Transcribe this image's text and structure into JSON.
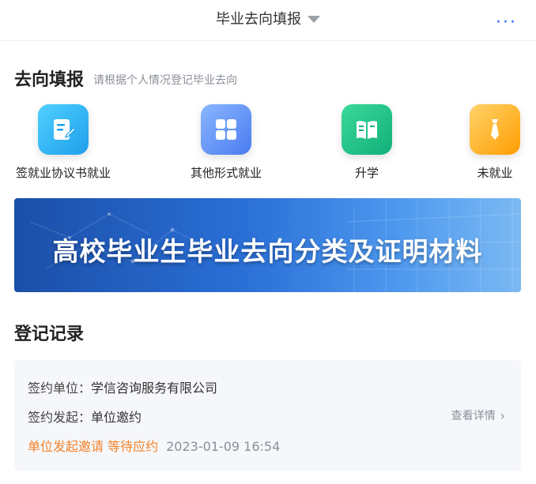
{
  "header": {
    "title": "毕业去向填报",
    "more_label": "···"
  },
  "section": {
    "title": "去向填报",
    "subtitle": "请根据个人情况登记毕业去向"
  },
  "tiles": [
    {
      "label": "签就业协议书就业",
      "icon": "contract-edit-icon",
      "color": "#1f9eea"
    },
    {
      "label": "其他形式就业",
      "icon": "grid-apps-icon",
      "color": "#4a7bf0"
    },
    {
      "label": "升学",
      "icon": "book-icon",
      "color": "#12b07a"
    },
    {
      "label": "未就业",
      "icon": "tie-icon",
      "color": "#ff9d00"
    }
  ],
  "banner": {
    "text": "高校毕业生毕业去向分类及证明材料"
  },
  "records": {
    "title": "登记记录",
    "items": [
      {
        "unit_key": "签约单位：",
        "unit_value": "学信咨询服务有限公司",
        "initiator_key": "签约发起：",
        "initiator_value": "单位邀约",
        "status": "单位发起邀请 等待应约",
        "time": "2023-01-09 16:54",
        "detail_label": "查看详情"
      }
    ]
  },
  "colors": {
    "accent": "#2f6bff",
    "warning": "#f5822a",
    "card_bg": "#f5f7fb"
  }
}
